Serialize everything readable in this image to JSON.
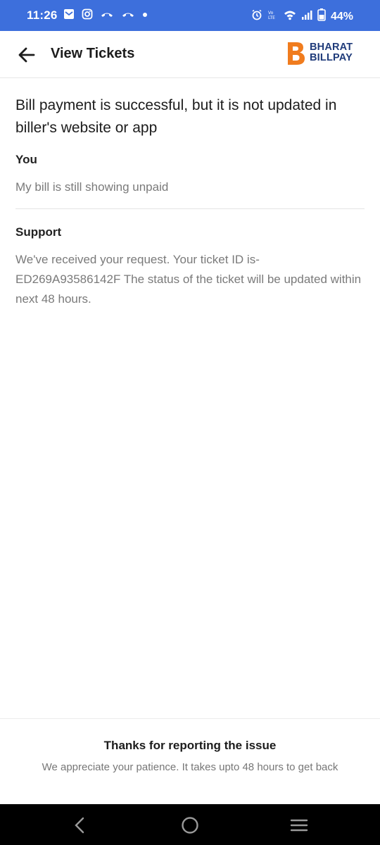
{
  "status_bar": {
    "time": "11:26",
    "battery": "44%",
    "color": "#3d6fdc"
  },
  "header": {
    "title": "View Tickets",
    "logo_line1": "BHARAT",
    "logo_line2": "BILLPAY",
    "logo_accent": "#f07c1e"
  },
  "ticket": {
    "topic": "Bill payment is successful, but it is not updated in biller's website or app",
    "messages": [
      {
        "author": "You",
        "text": "My bill is still showing unpaid"
      },
      {
        "author": "Support",
        "text": "We've received your request. Your ticket ID is- ED269A93586142F The status of the ticket will be updated within next 48 hours."
      }
    ]
  },
  "bottom_panel": {
    "title": "Thanks for reporting the issue",
    "subtitle": "We appreciate your patience. It takes upto 48 hours to get back"
  }
}
